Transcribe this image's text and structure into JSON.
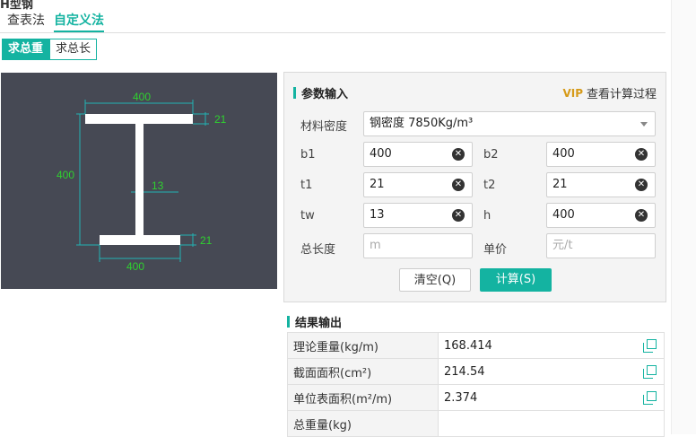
{
  "header": {
    "cut_title": "H型钢"
  },
  "tabs": [
    {
      "label": "查表法"
    },
    {
      "label": "自定义法"
    }
  ],
  "modes": [
    {
      "label": "求总重"
    },
    {
      "label": "求总长"
    }
  ],
  "diagram": {
    "b1": "400",
    "b2": "400",
    "t1": "21",
    "t2": "21",
    "tw": "13",
    "h": "400"
  },
  "panel": {
    "title": "参数输入",
    "calc_link": "查看计算过程",
    "vip_mark": "VIP",
    "density_label": "材料密度",
    "density_value": "钢密度 7850Kg/m³",
    "b1_label": "b1",
    "b1_value": "400",
    "b2_label": "b2",
    "b2_value": "400",
    "t1_label": "t1",
    "t1_value": "21",
    "t2_label": "t2",
    "t2_value": "21",
    "tw_label": "tw",
    "tw_value": "13",
    "h_label": "h",
    "h_value": "400",
    "length_label": "总长度",
    "length_placeholder": "m",
    "price_label": "单价",
    "price_placeholder": "元/t",
    "clear_btn": "清空(Q)",
    "calc_btn": "计算(S)"
  },
  "results": {
    "title": "结果输出",
    "rows": [
      {
        "key": "理论重量(kg/m)",
        "value": "168.414"
      },
      {
        "key": "截面面积(cm²)",
        "value": "214.54"
      },
      {
        "key": "单位表面积(m²/m)",
        "value": "2.374"
      },
      {
        "key": "总重量(kg)",
        "value": ""
      }
    ]
  }
}
